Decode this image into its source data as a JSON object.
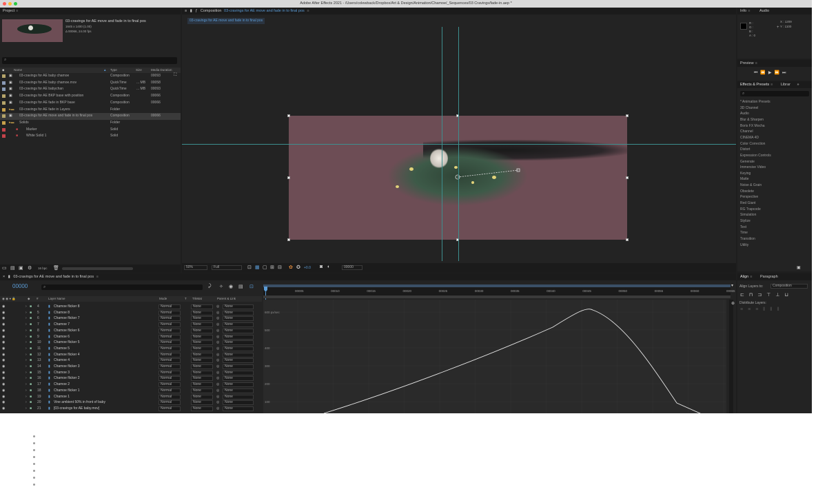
{
  "window": {
    "title": "Adobe After Effects 2021 - /Users/colewback/Dropbox/Art & Design/Animation/Chamoe/_Sequences/03 Cravings/fade-in.aep *",
    "traffic_colors": [
      "#ff5f57",
      "#febc2e",
      "#28c840"
    ]
  },
  "project": {
    "tab": "Project",
    "selected_name": "03-cravings for AE move and fade in to final pos",
    "selected_dims": "1645 x 1400 (1.00)",
    "selected_duration": "Δ 00066, 24.00 fps",
    "columns": [
      "Name",
      "Type",
      "Size",
      "Media Duration"
    ],
    "items": [
      {
        "name": "03-cravings for AE baby chamoe",
        "type": "Composition",
        "size": "",
        "dur": "00093",
        "color": "#b5a46a",
        "indent": 0
      },
      {
        "name": "03-cravings for AE baby chamoe.mov",
        "type": "QuickTime",
        "size": "... MB",
        "dur": "00058",
        "color": "#8a9ab6",
        "indent": 0
      },
      {
        "name": "03-cravings for AE babychan",
        "type": "QuickTime",
        "size": "... MB",
        "dur": "00093",
        "color": "#8a9ab6",
        "indent": 0
      },
      {
        "name": "03-cravings for AE BKP base with position",
        "type": "Composition",
        "size": "",
        "dur": "00066",
        "color": "#b5a46a",
        "indent": 0
      },
      {
        "name": "03-cravings for AE fade in BKP base",
        "type": "Composition",
        "size": "",
        "dur": "00066",
        "color": "#b5a46a",
        "indent": 0
      },
      {
        "name": "03-cravings for AE fade in Layers",
        "type": "Folder",
        "size": "",
        "dur": "",
        "color": "#c8a04a",
        "indent": 0
      },
      {
        "name": "03-cravings for AE move and fade in to final pos",
        "type": "Composition",
        "size": "",
        "dur": "00066",
        "color": "#b5a46a",
        "indent": 0,
        "selected": true
      },
      {
        "name": "Solids",
        "type": "Folder",
        "size": "",
        "dur": "",
        "color": "#c8a04a",
        "indent": 0
      },
      {
        "name": "Marker",
        "type": "Solid",
        "size": "",
        "dur": "",
        "color": "#c4434a",
        "indent": 1
      },
      {
        "name": "White Solid 1",
        "type": "Solid",
        "size": "",
        "dur": "",
        "color": "#c4434a",
        "indent": 1
      }
    ],
    "bpc": "16 bpc"
  },
  "composition": {
    "tab_prefix": "Composition",
    "tab_name": "03-cravings for AE move and fade in to final pos",
    "breadcrumb": "03-cravings for AE move and fade in to final pos",
    "zoom": "50%",
    "resolution": "Full",
    "exposure": "+0.0",
    "timecode": "00000"
  },
  "info": {
    "tabs": [
      "Info",
      "Audio"
    ],
    "channels": [
      "R :",
      "G :",
      "B :",
      "A : 0"
    ],
    "x": "X : 1209",
    "y": "Y : 1100"
  },
  "preview": {
    "title": "Preview"
  },
  "effects": {
    "tabs": [
      "Effects & Presets",
      "Librar"
    ],
    "items": [
      "* Animation Presets",
      "3D Channel",
      "Audio",
      "Blur & Sharpen",
      "Boris FX Mocha",
      "Channel",
      "CINEMA 4D",
      "Color Correction",
      "Distort",
      "Expression Controls",
      "Generate",
      "Immersive Video",
      "Keying",
      "Matte",
      "Noise & Grain",
      "Obsolete",
      "Perspective",
      "Red Giant",
      "RG Trapcode",
      "Simulation",
      "Stylize",
      "Text",
      "Time",
      "Transition",
      "Utility"
    ]
  },
  "align": {
    "tabs": [
      "Align",
      "Paragraph"
    ],
    "align_to_label": "Align Layers to:",
    "align_to_value": "Composition",
    "distribute_label": "Distribute Layers:"
  },
  "timeline": {
    "tab": "03-cravings for AE move and fade in to final pos",
    "timecode": "00000",
    "columns": [
      "Layer Name",
      "Mode",
      "T",
      "TrkMat",
      "Parent & Link"
    ],
    "ruler": [
      "00005",
      "00010",
      "00015",
      "00020",
      "00025",
      "00030",
      "00035",
      "00040",
      "00045",
      "00050",
      "00055",
      "00060",
      "00065"
    ],
    "graph_labels": [
      "600 px/sec",
      "500",
      "400",
      "300",
      "200",
      "100"
    ],
    "layers": [
      {
        "num": "4",
        "name": "Chamoe flicker 8",
        "mode": "Normal",
        "trk": "None",
        "parent": "None"
      },
      {
        "num": "5",
        "name": "Chamoe 8",
        "mode": "Normal",
        "trk": "None",
        "parent": "None"
      },
      {
        "num": "6",
        "name": "Chamoe flicker 7",
        "mode": "Normal",
        "trk": "None",
        "parent": "None"
      },
      {
        "num": "7",
        "name": "Chamoe 7",
        "mode": "Normal",
        "trk": "None",
        "parent": "None"
      },
      {
        "num": "8",
        "name": "Chamoe flicker 6",
        "mode": "Normal",
        "trk": "None",
        "parent": "None"
      },
      {
        "num": "9",
        "name": "Chamoe 6",
        "mode": "Normal",
        "trk": "None",
        "parent": "None"
      },
      {
        "num": "10",
        "name": "Chamoe flicker 5",
        "mode": "Normal",
        "trk": "None",
        "parent": "None"
      },
      {
        "num": "11",
        "name": "Chamoe 5",
        "mode": "Normal",
        "trk": "None",
        "parent": "None"
      },
      {
        "num": "12",
        "name": "Chamoe flicker 4",
        "mode": "Normal",
        "trk": "None",
        "parent": "None"
      },
      {
        "num": "13",
        "name": "Chamoe 4",
        "mode": "Normal",
        "trk": "None",
        "parent": "None"
      },
      {
        "num": "14",
        "name": "Chamoe flicker 3",
        "mode": "Normal",
        "trk": "None",
        "parent": "None"
      },
      {
        "num": "15",
        "name": "Chamoe 3",
        "mode": "Normal",
        "trk": "None",
        "parent": "None"
      },
      {
        "num": "16",
        "name": "Chamoe flicker 2",
        "mode": "Normal",
        "trk": "None",
        "parent": "None"
      },
      {
        "num": "17",
        "name": "Chamoe 2",
        "mode": "Normal",
        "trk": "None",
        "parent": "None"
      },
      {
        "num": "18",
        "name": "Chamoe flicker 1",
        "mode": "Normal",
        "trk": "None",
        "parent": "None"
      },
      {
        "num": "19",
        "name": "Chamoe 1",
        "mode": "Normal",
        "trk": "None",
        "parent": "None"
      },
      {
        "num": "20",
        "name": "Vine ambient 50% in front of baby",
        "mode": "Normal",
        "trk": "None",
        "parent": "None"
      },
      {
        "num": "21",
        "name": "[03-cravings for AE baby.mov]",
        "mode": "Normal",
        "trk": "None",
        "parent": "None"
      }
    ]
  },
  "colors": {
    "accent": "#2d8ceb",
    "guide": "#3d8f8f",
    "comp_bg": "#6d4d55",
    "label_green": "#8fc3a5"
  }
}
